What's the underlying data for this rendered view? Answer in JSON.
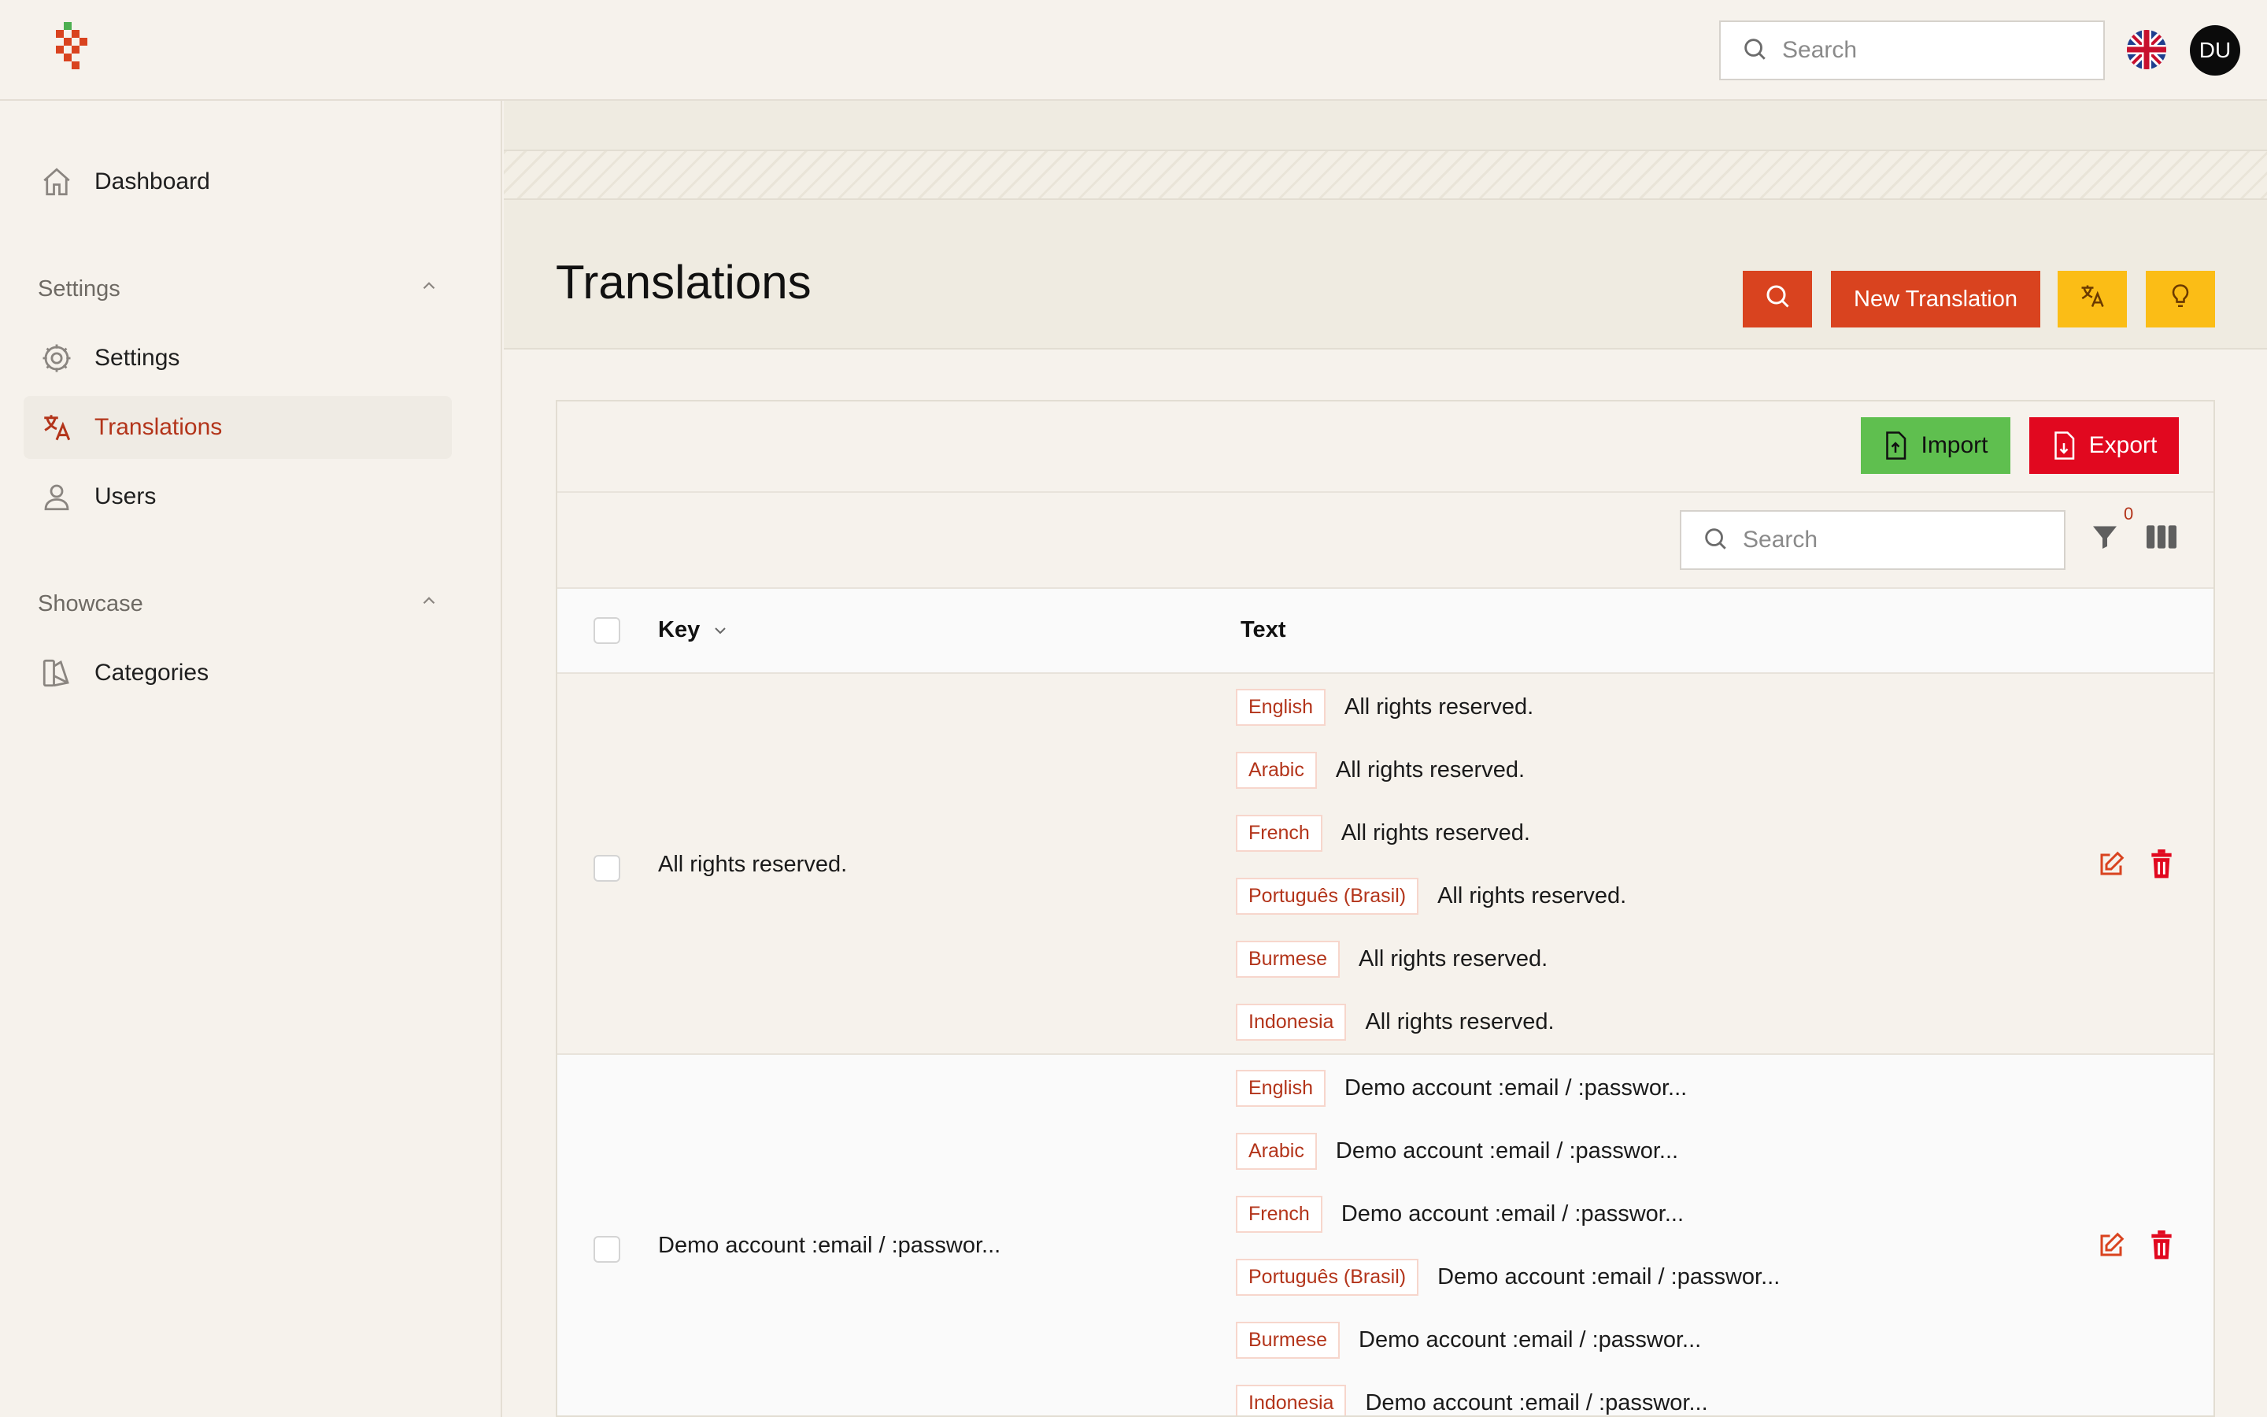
{
  "topbar": {
    "search_placeholder": "Search",
    "avatar_initials": "DU",
    "language_flag": "uk-flag-icon"
  },
  "sidebar": {
    "items": [
      {
        "label": "Dashboard",
        "icon": "home-icon"
      }
    ],
    "groups": [
      {
        "title": "Settings",
        "items": [
          {
            "label": "Settings",
            "icon": "gear-icon"
          },
          {
            "label": "Translations",
            "icon": "translate-icon",
            "active": true
          },
          {
            "label": "Users",
            "icon": "user-icon"
          }
        ]
      },
      {
        "title": "Showcase",
        "items": [
          {
            "label": "Categories",
            "icon": "categories-icon"
          }
        ]
      }
    ]
  },
  "page": {
    "title": "Translations",
    "new_button": "New Translation"
  },
  "toolbar": {
    "import_label": "Import",
    "export_label": "Export",
    "search_placeholder": "Search",
    "filter_count": "0"
  },
  "table": {
    "columns": [
      "Key",
      "Text"
    ],
    "rows": [
      {
        "key": "All rights reserved.",
        "translations": [
          {
            "lang": "English",
            "text": "All rights reserved."
          },
          {
            "lang": "Arabic",
            "text": "All rights reserved."
          },
          {
            "lang": "French",
            "text": "All rights reserved."
          },
          {
            "lang": "Português (Brasil)",
            "text": "All rights reserved."
          },
          {
            "lang": "Burmese",
            "text": "All rights reserved."
          },
          {
            "lang": "Indonesia",
            "text": "All rights reserved."
          }
        ]
      },
      {
        "key": "Demo account :email / :passwor...",
        "translations": [
          {
            "lang": "English",
            "text": "Demo account :email / :passwor..."
          },
          {
            "lang": "Arabic",
            "text": "Demo account :email / :passwor..."
          },
          {
            "lang": "French",
            "text": "Demo account :email / :passwor..."
          },
          {
            "lang": "Português (Brasil)",
            "text": "Demo account :email / :passwor..."
          },
          {
            "lang": "Burmese",
            "text": "Demo account :email / :passwor..."
          },
          {
            "lang": "Indonesia",
            "text": "Demo account :email / :passwor..."
          }
        ]
      }
    ]
  },
  "colors": {
    "accent": "#d9431f",
    "warning": "#fbbd16",
    "success": "#5fbf4f",
    "danger": "#e1081f"
  }
}
